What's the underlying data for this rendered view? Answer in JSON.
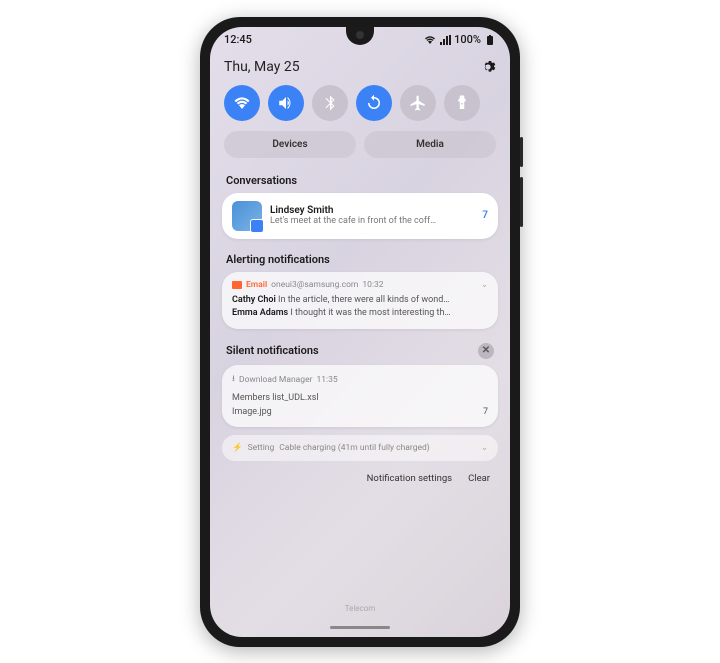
{
  "status": {
    "time": "12:45",
    "battery": "100%"
  },
  "header": {
    "date": "Thu, May 25"
  },
  "buttons": {
    "devices": "Devices",
    "media": "Media"
  },
  "sections": {
    "conversations": "Conversations",
    "alerting": "Alerting notifications",
    "silent": "Silent notifications"
  },
  "conv": {
    "name": "Lindsey Smith",
    "msg": "Let's meet at the cafe in front of the coff…",
    "count": "7"
  },
  "email": {
    "app": "Email",
    "account": "oneui3@samsung.com",
    "time": "10:32",
    "items": [
      {
        "sender": "Cathy Choi",
        "preview": "In the article, there were all kinds of wond…"
      },
      {
        "sender": "Emma Adams",
        "preview": "I thought it was the most interesting th…"
      }
    ]
  },
  "download": {
    "app": "Download Manager",
    "time": "11:35",
    "files": [
      "Members list_UDL.xsl",
      "Image.jpg"
    ],
    "count": "7"
  },
  "charging": {
    "app": "Setting",
    "text": "Cable charging (41m until fully charged)"
  },
  "footer": {
    "settings": "Notification settings",
    "clear": "Clear"
  },
  "carrier": "Telecom"
}
